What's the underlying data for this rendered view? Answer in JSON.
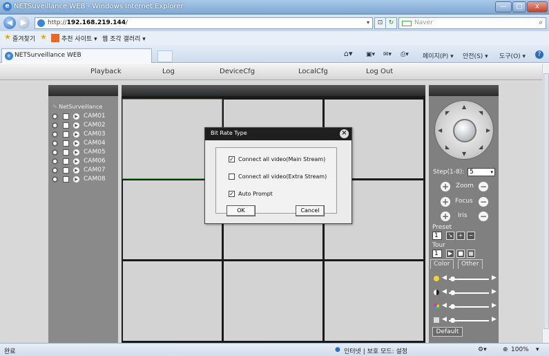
{
  "window": {
    "title": "NETSuveillance WEB - Windows Internet Explorer",
    "min": "—",
    "max": "□",
    "close": "x"
  },
  "address": {
    "url_prefix": "http://",
    "url_host": "192.168.219.144",
    "url_suffix": "/",
    "search_placeholder": "Naver"
  },
  "favorites": {
    "label": "즐겨찾기",
    "suggested": "추천 사이트 ▾",
    "webslice": "웹 조각 갤러리 ▾"
  },
  "tab": {
    "title": "NETSurveillance WEB"
  },
  "commandbar": {
    "page": "페이지(P) ▾",
    "safety": "안전(S) ▾",
    "tools": "도구(O) ▾",
    "help": "?"
  },
  "menu": {
    "items": [
      "Playback",
      "Log",
      "DeviceCfg",
      "LocalCfg",
      "Log Out"
    ]
  },
  "tree": {
    "root": "NetSurveillance",
    "cams": [
      "CAM01",
      "CAM02",
      "CAM03",
      "CAM04",
      "CAM05",
      "CAM06",
      "CAM07",
      "CAM08"
    ]
  },
  "ptz": {
    "step_label": "Step(1-8):",
    "step_value": "5",
    "zoom": "Zoom",
    "focus": "Focus",
    "iris": "Iris",
    "preset_label": "Preset",
    "preset_value": "1",
    "tour_label": "Tour",
    "tour_value": "1",
    "color_tab": "Color",
    "other_tab": "Other",
    "default_btn": "Default"
  },
  "dialog": {
    "title": "Bit Rate Type",
    "options": [
      {
        "label": "Connect all video(Main Stream)",
        "checked": true
      },
      {
        "label": "Connect all video(Extra Stream)",
        "checked": false
      },
      {
        "label": "Auto Prompt",
        "checked": true
      }
    ],
    "ok": "OK",
    "cancel": "Cancel"
  },
  "status": {
    "left": "완료",
    "zone": "인터넷 | 보호 모드: 설정",
    "zoom": "100%"
  },
  "colors": {
    "accent_green": "#4ca34c",
    "titlebar": "#7fa9d6"
  }
}
